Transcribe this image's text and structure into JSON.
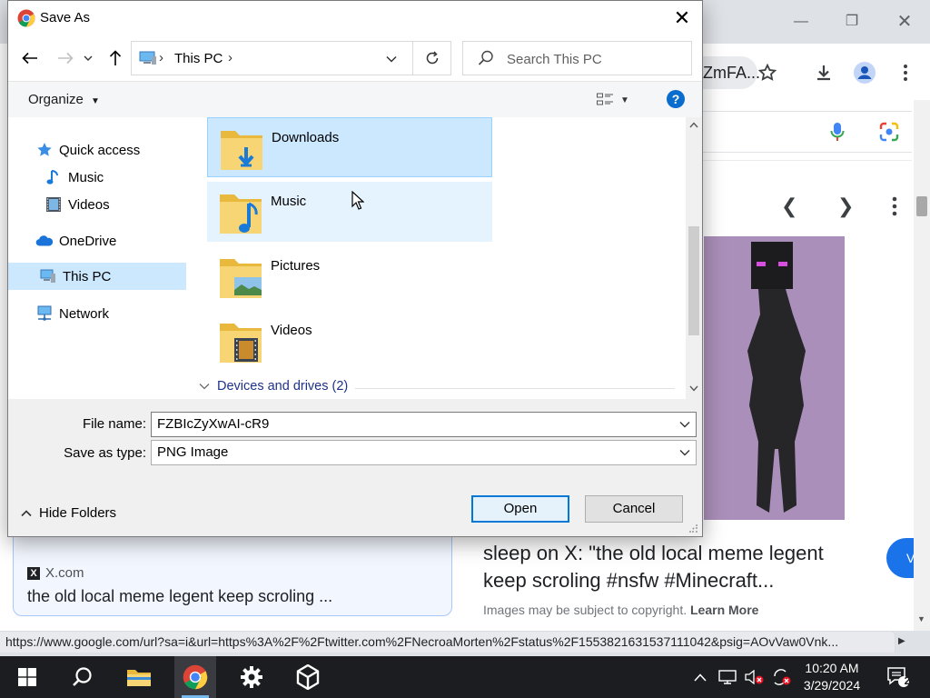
{
  "browser": {
    "omnibox_fragment": "ZmFA...",
    "viewer_title": "sleep on X: \"the old local meme legent keep scroling #nsfw #Minecraft...",
    "viewer_copyright_prefix": "Images may be subject to copyright.",
    "learn_more": "Learn More",
    "visit_label": "V",
    "result_source": "X.com",
    "result_title": "the old local meme legent keep scroling ...",
    "status_url": "https://www.google.com/url?sa=i&url=https%3A%2F%2Ftwitter.com%2FNecroaMorten%2Fstatus%2F1553821631537111042&psig=AOvVaw0Vnk..."
  },
  "dialog": {
    "title": "Save As",
    "address_path": "This PC",
    "search_placeholder": "Search This PC",
    "organize_label": "Organize",
    "nav_items": [
      {
        "label": "Quick access",
        "icon": "star-icon"
      },
      {
        "label": "Music",
        "icon": "music-icon"
      },
      {
        "label": "Videos",
        "icon": "film-icon"
      },
      {
        "label": "OneDrive",
        "icon": "cloud-icon"
      },
      {
        "label": "This PC",
        "icon": "computer-icon",
        "selected": true
      },
      {
        "label": "Network",
        "icon": "network-icon"
      }
    ],
    "folders": [
      {
        "name": "Downloads",
        "state": "selected"
      },
      {
        "name": "Music",
        "state": "hover"
      },
      {
        "name": "Pictures",
        "state": "normal"
      },
      {
        "name": "Videos",
        "state": "normal"
      }
    ],
    "devices_group": "Devices and drives (2)",
    "file_name_label": "File name:",
    "file_name_value": "FZBIcZyXwAI-cR9",
    "save_type_label": "Save as type:",
    "save_type_value": "PNG Image",
    "hide_folders_label": "Hide Folders",
    "open_label": "Open",
    "cancel_label": "Cancel"
  },
  "taskbar": {
    "time": "10:20 AM",
    "date": "3/29/2024",
    "notification_count": "2"
  },
  "colors": {
    "accent": "#0078d7",
    "selection": "#cce8ff",
    "taskbar": "#1c1d20"
  }
}
